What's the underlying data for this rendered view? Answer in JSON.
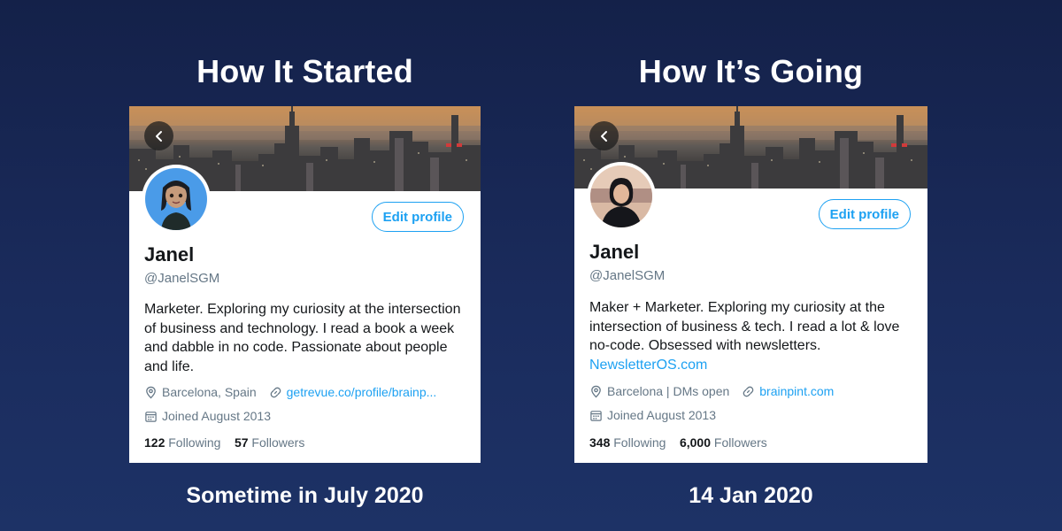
{
  "left": {
    "heading": "How It Started",
    "caption": "Sometime in July 2020",
    "profile": {
      "edit_label": "Edit profile",
      "name": "Janel",
      "handle": "@JanelSGM",
      "bio": "Marketer. Exploring my curiosity at the intersection of business and technology. I read a book a week and dabble in no code. Passionate about people and life.",
      "location": "Barcelona, Spain",
      "website": "getrevue.co/profile/brainp...",
      "joined": "Joined August 2013",
      "following_count": "122",
      "following_label": "Following",
      "followers_count": "57",
      "followers_label": "Followers"
    }
  },
  "right": {
    "heading": "How It’s Going",
    "caption": "14 Jan 2020",
    "profile": {
      "edit_label": "Edit profile",
      "name": "Janel",
      "handle": "@JanelSGM",
      "bio": "Maker + Marketer. Exploring my curiosity at the intersection of business & tech. I read a lot & love no-code. Obsessed with newsletters.",
      "bio_link": "NewsletterOS.com",
      "location": "Barcelona | DMs open",
      "website": "brainpint.com",
      "joined": "Joined August 2013",
      "following_count": "348",
      "following_label": "Following",
      "followers_count": "6,000",
      "followers_label": "Followers"
    }
  },
  "colors": {
    "accent": "#1da1f2",
    "background": "#152350",
    "secondary_text": "#657786"
  },
  "icons": [
    "back-arrow-icon",
    "location-pin-icon",
    "link-icon",
    "calendar-icon"
  ]
}
